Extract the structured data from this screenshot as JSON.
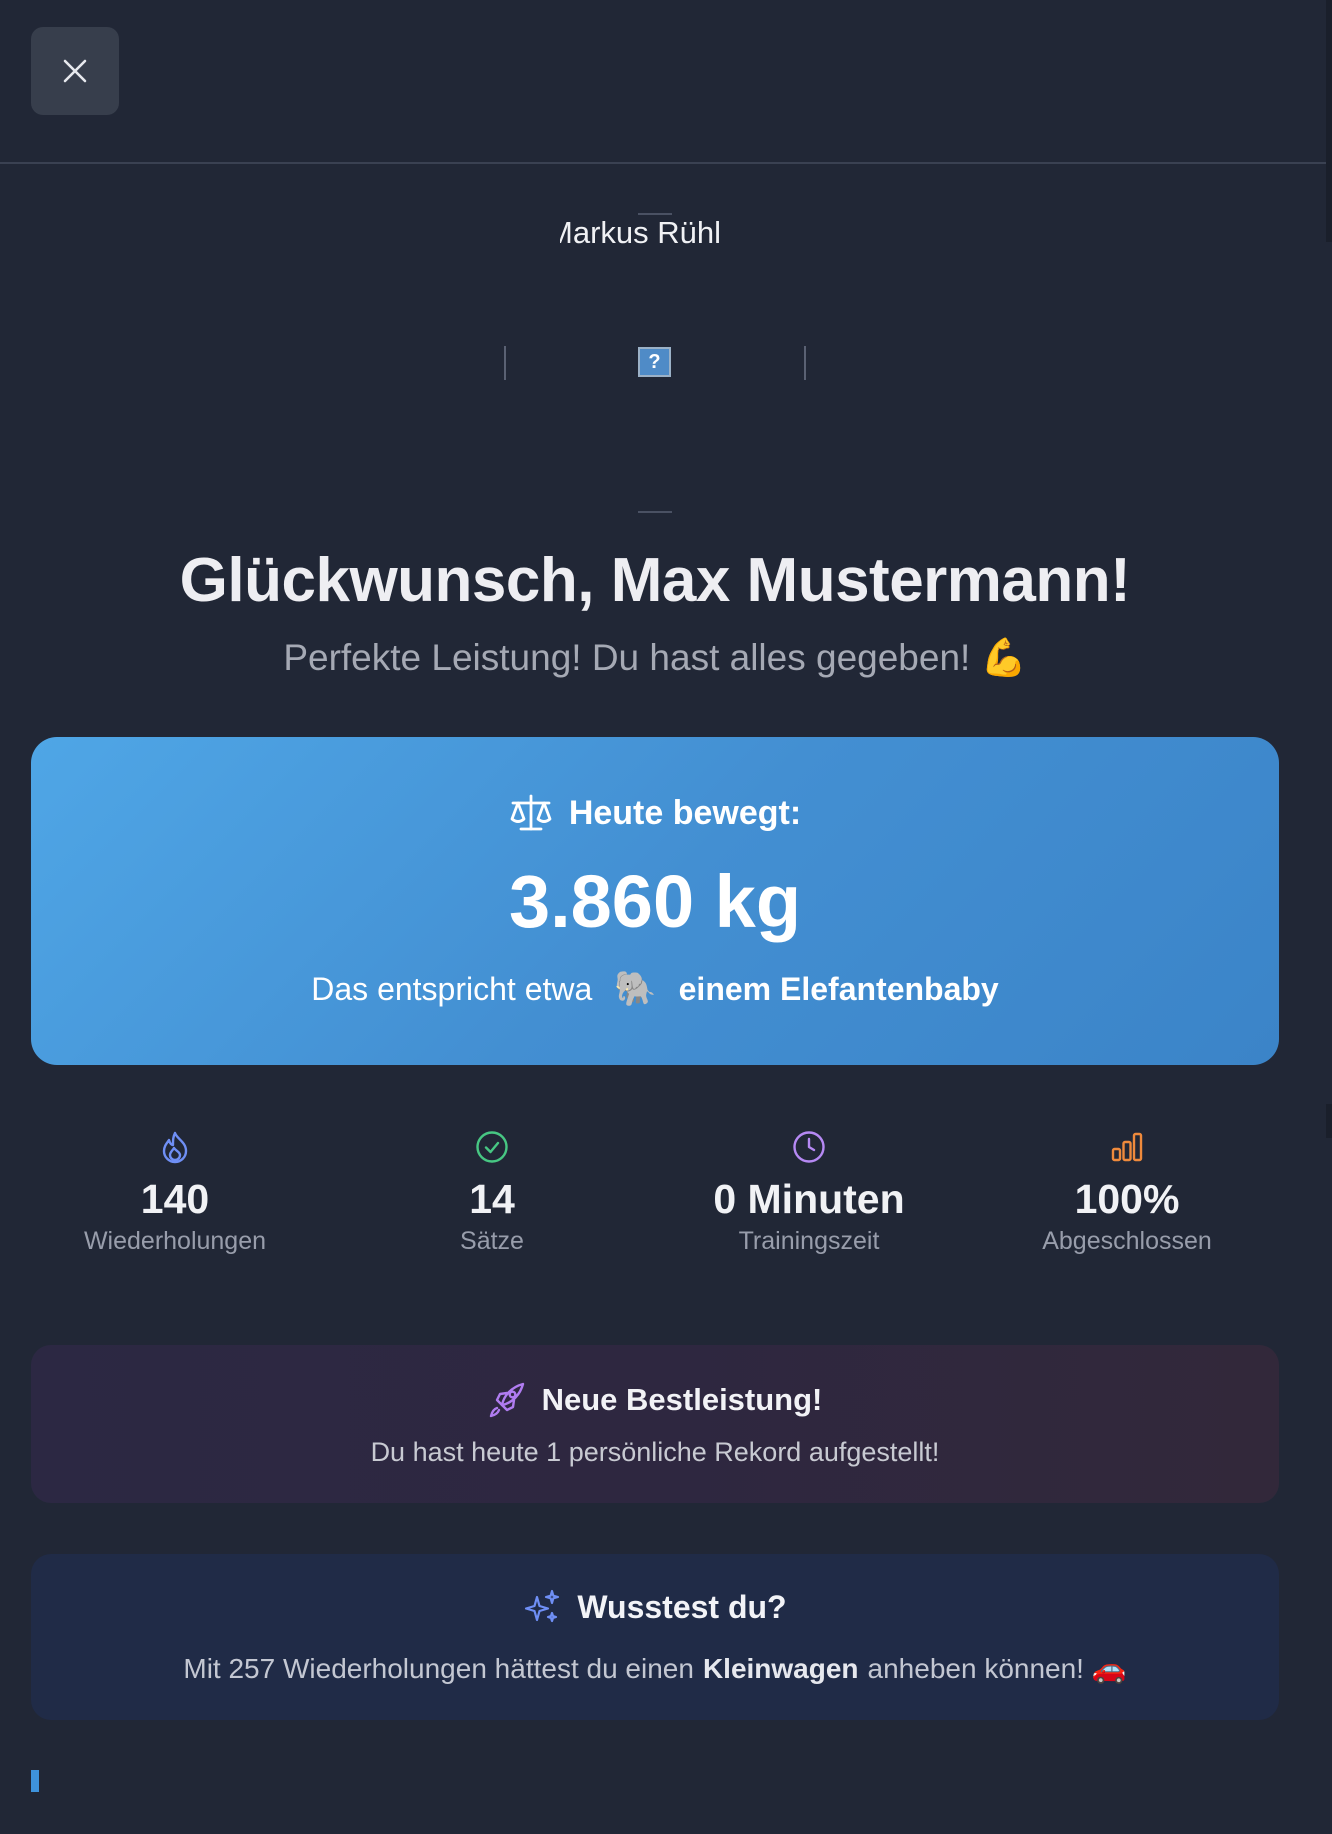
{
  "header": {
    "close_icon": "close-icon"
  },
  "hero": {
    "name_text": "Markus Rühl",
    "image_placeholder": "?"
  },
  "congrats": {
    "title": "Glückwunsch, Max Mustermann!",
    "subtitle": "Perfekte Leistung! Du hast alles gegeben! 💪"
  },
  "weight": {
    "icon": "scale-icon",
    "label": "Heute bewegt:",
    "value": "3.860 kg",
    "compare_prefix": "Das entspricht etwa",
    "compare_emoji": "🐘",
    "compare_object": "einem Elefantenbaby"
  },
  "stats": [
    {
      "icon": "flame-icon",
      "value": "140",
      "label": "Wiederholungen",
      "color": "#6f8ff5"
    },
    {
      "icon": "check-circle-icon",
      "value": "14",
      "label": "Sätze",
      "color": "#47c783"
    },
    {
      "icon": "clock-icon",
      "value": "0 Minuten",
      "label": "Trainingszeit",
      "color": "#b689f4"
    },
    {
      "icon": "bar-chart-icon",
      "value": "100%",
      "label": "Abgeschlossen",
      "color": "#ef8a3c"
    }
  ],
  "record": {
    "icon": "rocket-icon",
    "title": "Neue Bestleistung!",
    "text": "Du hast heute 1 persönliche Rekord aufgestellt!"
  },
  "fact": {
    "icon": "sparkles-icon",
    "title": "Wusstest du?",
    "text_before": "Mit 257 Wiederholungen hättest du einen",
    "text_strong": "Kleinwagen",
    "text_after": "anheben können! 🚗"
  },
  "colors": {
    "background": "#212736",
    "card_gradient_start": "#4fa6e6",
    "card_gradient_end": "#3b84c8",
    "progress_accent": "#3e93dd"
  }
}
